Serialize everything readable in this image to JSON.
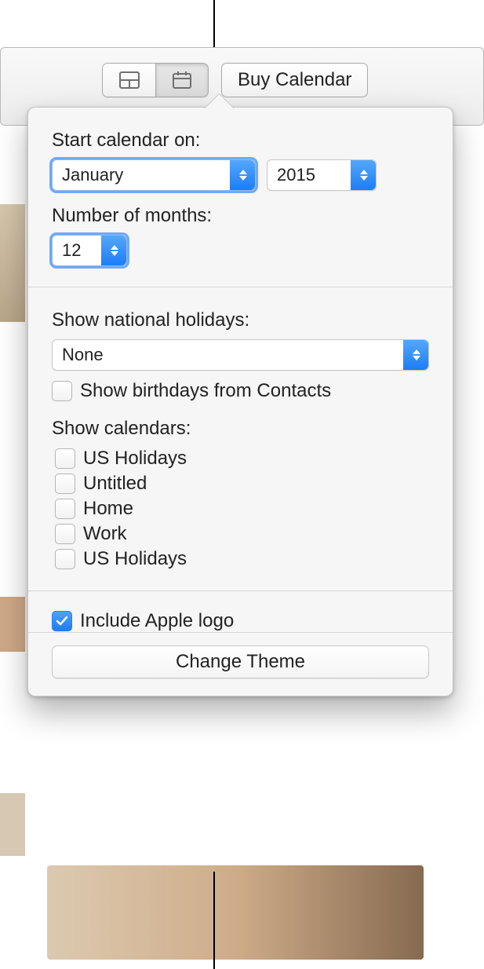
{
  "toolbar": {
    "layout_icon": "layout-icon",
    "settings_icon": "calendar-settings-icon",
    "buy_label": "Buy Calendar"
  },
  "popover": {
    "start_label": "Start calendar on:",
    "month_value": "January",
    "year_value": "2015",
    "num_months_label": "Number of months:",
    "num_months_value": "12",
    "holidays_label": "Show national holidays:",
    "holidays_value": "None",
    "show_birthdays_label": "Show birthdays from Contacts",
    "show_birthdays_checked": false,
    "show_calendars_label": "Show calendars:",
    "calendars": [
      {
        "label": "US Holidays",
        "checked": false
      },
      {
        "label": "Untitled",
        "checked": false
      },
      {
        "label": "Home",
        "checked": false
      },
      {
        "label": "Work",
        "checked": false
      },
      {
        "label": "US Holidays",
        "checked": false
      }
    ],
    "include_logo_label": "Include Apple logo",
    "include_logo_checked": true,
    "change_theme_label": "Change Theme"
  }
}
